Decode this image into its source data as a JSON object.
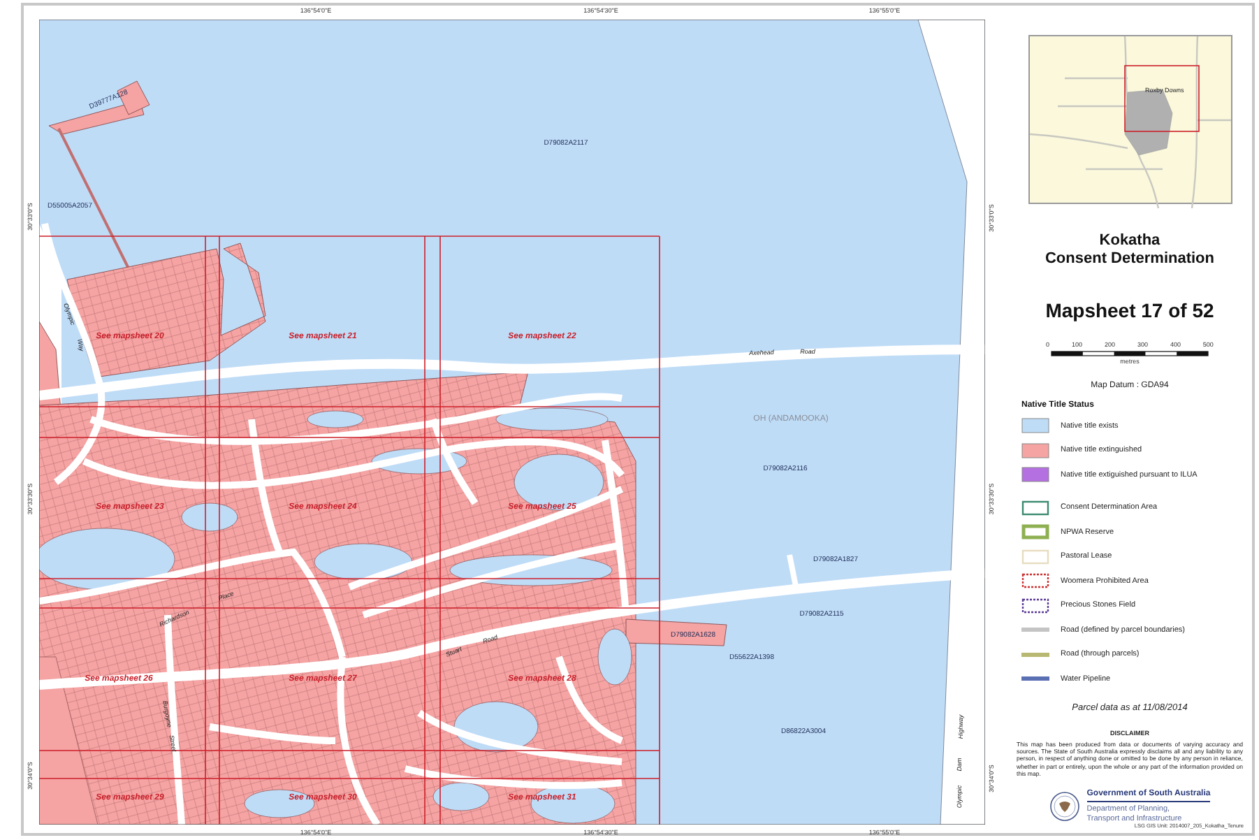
{
  "map": {
    "top_ticks": [
      "136°54'0\"E",
      "136°54'30\"E",
      "136°55'0\"E"
    ],
    "bottom_ticks": [
      "136°54'0\"E",
      "136°54'30\"E",
      "136°55'0\"E"
    ],
    "left_ticks": [
      "30°33'0\"S",
      "30°33'30\"S",
      "30°34'0\"S"
    ],
    "right_ticks": [
      "30°33'0\"S",
      "30°33'30\"S",
      "30°34'0\"S"
    ],
    "parcel_labels": [
      "D39777A128",
      "D79082A2117",
      "D55005A2057",
      "D79082A2116",
      "D79082A1827",
      "D79082A2115",
      "D79082A1628",
      "D55622A1398",
      "D86822A3004"
    ],
    "locality_label": "OH (ANDAMOOKA)",
    "road_labels": [
      "Axehead",
      "Road",
      "Olympic",
      "Way",
      "Richardson",
      "Place",
      "Stuart",
      "Road",
      "Burgoyne",
      "Street",
      "Olympic",
      "Dam",
      "Highway"
    ],
    "mapsheet_labels": [
      "See mapsheet 20",
      "See mapsheet 21",
      "See mapsheet 22",
      "See mapsheet 23",
      "See mapsheet 24",
      "See mapsheet 25",
      "See mapsheet 26",
      "See mapsheet 27",
      "See mapsheet 28",
      "See mapsheet 29",
      "See mapsheet 30",
      "See mapsheet 31"
    ]
  },
  "legend": {
    "inset_place": "Roxby Downs",
    "title": [
      "Kokatha",
      "Consent Determination"
    ],
    "mapsheet": "Mapsheet 17 of 52",
    "scale_labels": [
      "0",
      "100",
      "200",
      "300",
      "400",
      "500"
    ],
    "scale_unit": "metres",
    "datum": "Map Datum : GDA94",
    "heading": "Native Title Status",
    "items": [
      {
        "kind": "fill",
        "color": "#bfdcf7",
        "label": "Native title exists"
      },
      {
        "kind": "fill",
        "color": "#f5a3a3",
        "label": "Native title extinguished"
      },
      {
        "kind": "fill",
        "color": "#b46fe0",
        "label": "Native title extiguished pursuant to ILUA"
      },
      {
        "kind": "outline",
        "color": "#3c8a70",
        "label": "Consent Determination Area"
      },
      {
        "kind": "thick",
        "color": "#8fb052",
        "label": "NPWA Reserve"
      },
      {
        "kind": "outline",
        "color": "#e6dcc0",
        "label": "Pastoral Lease"
      },
      {
        "kind": "hatched",
        "color": "#cc3333",
        "label": "Woomera Prohibited Area"
      },
      {
        "kind": "hatched",
        "color": "#5a3a96",
        "label": "Precious Stones Field"
      },
      {
        "kind": "line",
        "color": "#c4c4c4",
        "label": "Road (defined by parcel boundaries)"
      },
      {
        "kind": "line",
        "color": "#b8b872",
        "label": "Road (through parcels)"
      },
      {
        "kind": "line",
        "color": "#5b6fb3",
        "label": "Water Pipeline"
      }
    ],
    "date_note": "Parcel data as at 11/08/2014",
    "disclaimer_heading": "DISCLAIMER",
    "disclaimer": "This map has been produced from data or documents of varying accuracy and sources. The State of South Australia expressly disclaims all and any liability to any person, in respect of anything done or omitted to be done by any person in reliance, whether in part or entirely, upon the whole or any part of the information provided on this map.",
    "government": "Government of South Australia",
    "department": [
      "Department of Planning,",
      "Transport and Infrastructure"
    ],
    "footer": "LSG GIS Unit: 2014007_205_Kokatha_Tenure"
  }
}
